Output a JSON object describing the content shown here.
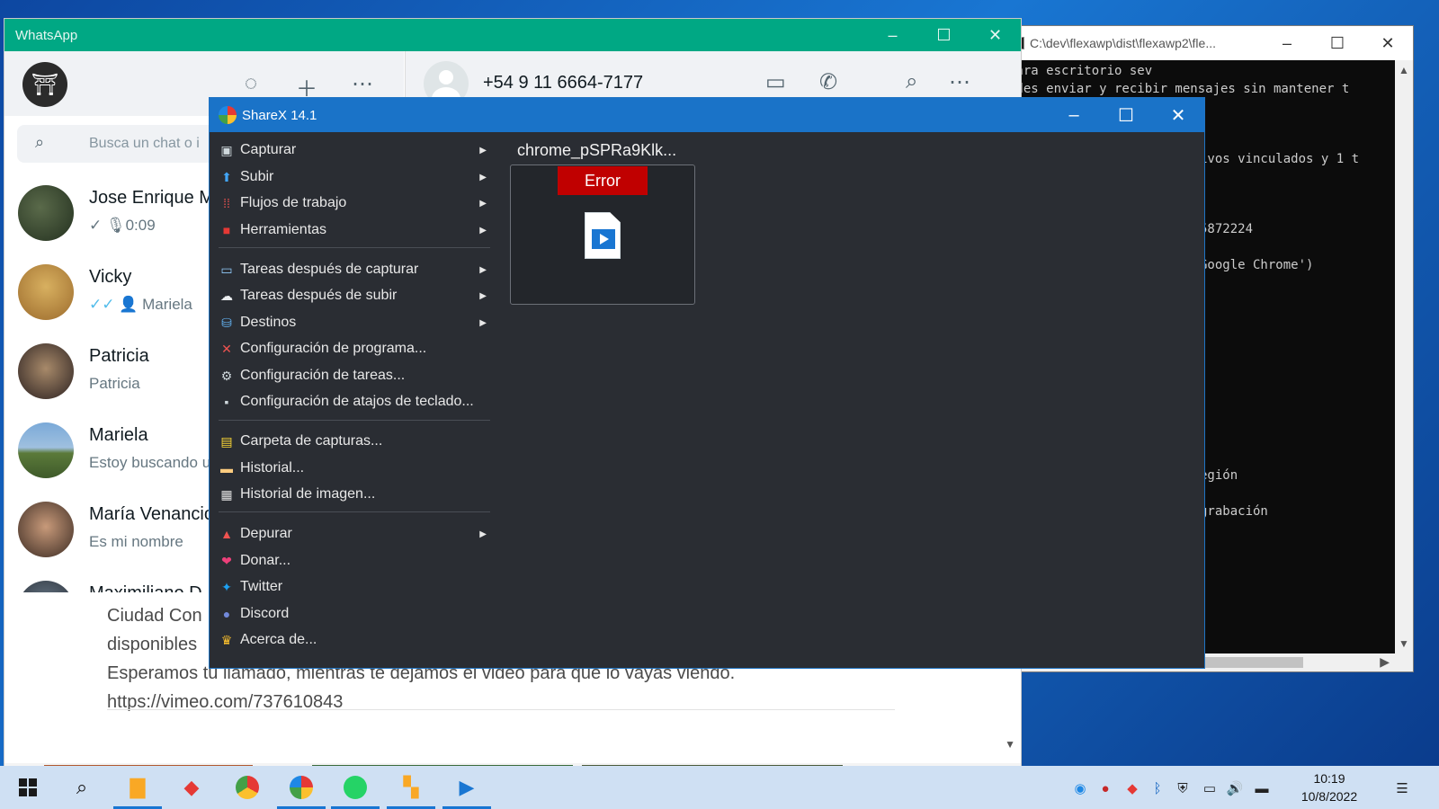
{
  "console": {
    "title": "C:\\dev\\flexawp\\dist\\flexawp2\\fle...",
    "lines": [
      " para escritorio sev",
      "edes enviar y recibir mensajes sin mantener t",
      "ivos vinculados y 1 t",
      "5872224",
      "Google Chrome')",
      "egión",
      "grabación"
    ]
  },
  "whatsapp": {
    "title": "WhatsApp",
    "contact_number": "+54 9 11 6664-7177",
    "search_placeholder": "Busca un chat o i",
    "chats": [
      {
        "name": "Jose Enrique M",
        "preview": "0:09",
        "tick": "✓"
      },
      {
        "name": "Vicky",
        "preview": "Mariela",
        "tick": "✓✓"
      },
      {
        "name": "Patricia",
        "preview": "Patricia",
        "tick": ""
      },
      {
        "name": "Mariela",
        "preview": "Estoy buscando u",
        "tick": ""
      },
      {
        "name": "María Venancio",
        "preview": "Es mi nombre",
        "tick": ""
      },
      {
        "name": "Maximiliano D",
        "preview": "",
        "tick": ""
      }
    ],
    "message_lines": [
      "Ciudad Con",
      "disponibles",
      "Esperamos tu llamado, mientras te dejamos el video para que lo vayas viendo.",
      "https://vimeo.com/737610843"
    ]
  },
  "sharex": {
    "title": "ShareX 14.1",
    "menu": [
      {
        "label": "Capturar",
        "icon": "camera-icon",
        "submenu": true
      },
      {
        "label": "Subir",
        "icon": "upload-arrow-icon",
        "submenu": true
      },
      {
        "label": "Flujos de trabajo",
        "icon": "workflow-grid-icon",
        "submenu": true
      },
      {
        "label": "Herramientas",
        "icon": "toolbox-icon",
        "submenu": true
      },
      {
        "label": "Tareas después de capturar",
        "icon": "image-tasks-icon",
        "submenu": true
      },
      {
        "label": "Tareas después de subir",
        "icon": "cloud-tasks-icon",
        "submenu": true
      },
      {
        "label": "Destinos",
        "icon": "destinations-icon",
        "submenu": true
      },
      {
        "label": "Configuración de programa...",
        "icon": "wrench-icon",
        "submenu": false
      },
      {
        "label": "Configuración de tareas...",
        "icon": "gear-icon",
        "submenu": false
      },
      {
        "label": "Configuración de atajos de teclado...",
        "icon": "keyboard-icon",
        "submenu": false
      },
      {
        "label": "Carpeta de capturas...",
        "icon": "folder-icon",
        "submenu": false
      },
      {
        "label": "Historial...",
        "icon": "history-icon",
        "submenu": false
      },
      {
        "label": "Historial de imagen...",
        "icon": "image-history-icon",
        "submenu": false
      },
      {
        "label": "Depurar",
        "icon": "debug-cone-icon",
        "submenu": true
      },
      {
        "label": "Donar...",
        "icon": "heart-icon",
        "submenu": false
      },
      {
        "label": "Twitter",
        "icon": "twitter-icon",
        "submenu": false
      },
      {
        "label": "Discord",
        "icon": "discord-icon",
        "submenu": false
      },
      {
        "label": "Acerca de...",
        "icon": "crown-icon",
        "submenu": false
      }
    ],
    "task": {
      "filename": "chrome_pSPRa9Klk...",
      "status": "Error"
    }
  },
  "taskbar": {
    "time": "10:19",
    "date": "10/8/2022"
  },
  "colors": {
    "whatsapp_green": "#00a884",
    "sharex_blue": "#1a73c8",
    "error_red": "#c00000",
    "sharex_bg": "#2a2d33"
  }
}
